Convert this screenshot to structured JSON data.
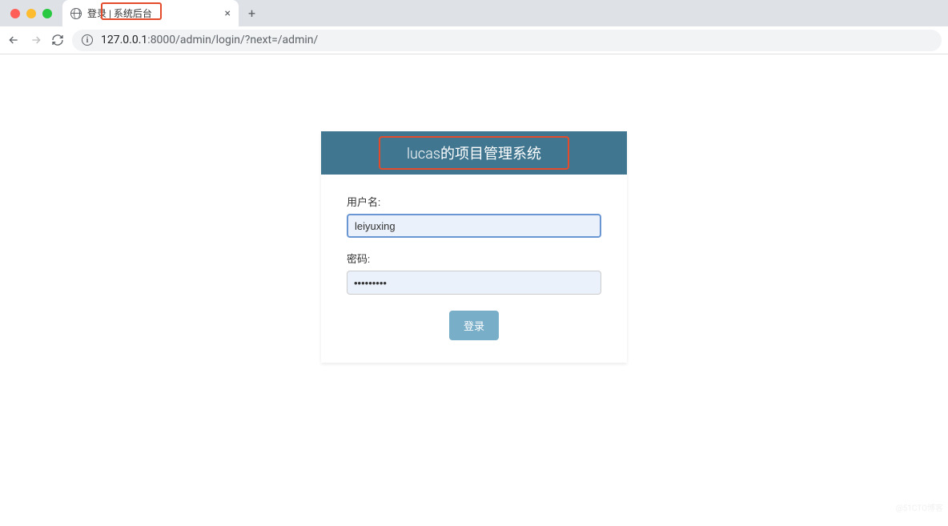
{
  "browser": {
    "tab_title": "登录 | 系统后台",
    "url_host": "127.0.0.1",
    "url_port_path": ":8000/admin/login/?next=/admin/"
  },
  "login": {
    "header_title": "lucas的项目管理系统",
    "username_label": "用户名:",
    "username_value": "leiyuxing",
    "password_label": "密码:",
    "password_value": "•••••••••",
    "submit_label": "登录"
  },
  "watermark": "@51CTO博客"
}
